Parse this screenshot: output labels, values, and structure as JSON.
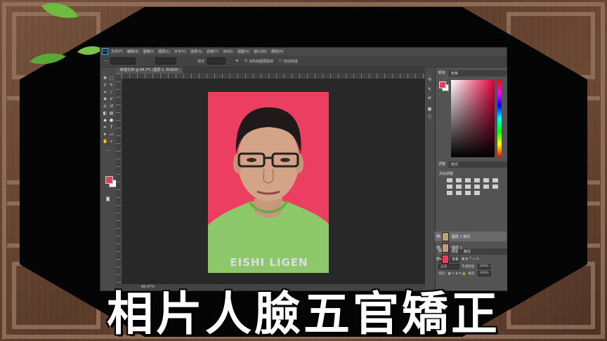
{
  "caption": "相片人臉五官矯正",
  "menu": {
    "logo": "Ps",
    "items": [
      "文件(F)",
      "编辑(E)",
      "图像(I)",
      "图层(L)",
      "文字(Y)",
      "选择(S)",
      "滤镜(T)",
      "3D(D)",
      "视图(V)",
      "窗口(W)",
      "帮助(H)"
    ]
  },
  "options_bar": {
    "style_label": "样式",
    "checkbox1_label": "对所有图层取样",
    "checkbox2_label": "自动增强"
  },
  "document_tab": "新建文档 @ 66.7% (图层 1, RGB/8)",
  "panels": {
    "color_tabs": [
      "颜色",
      "色板"
    ],
    "adjust_tabs": [
      "调整",
      "样式"
    ],
    "adjust_label": "添加调整",
    "layers_tabs": [
      "图层",
      "通道",
      "路径"
    ],
    "kind_label": "P 类型",
    "blend_mode": "正常",
    "opacity_label": "不透明度:",
    "opacity_value": "100%",
    "lock_label": "锁定:",
    "fill_label": "填充:",
    "fill_value": "100%"
  },
  "layers": [
    {
      "name": "图层 1 拷贝",
      "thumb": "#b9a57a",
      "selected": true
    },
    {
      "name": "图层 1",
      "thumb": "#c89b84",
      "selected": false
    },
    {
      "name": "背景",
      "thumb": "#ec3e5f",
      "selected": false
    }
  ],
  "status": "66.67%",
  "shirt_text": "EISHI LIGEN",
  "colors": {
    "foreground": "#ed3a57",
    "photo_background": "#ec3e5f",
    "shirt": "#8dc86a"
  }
}
